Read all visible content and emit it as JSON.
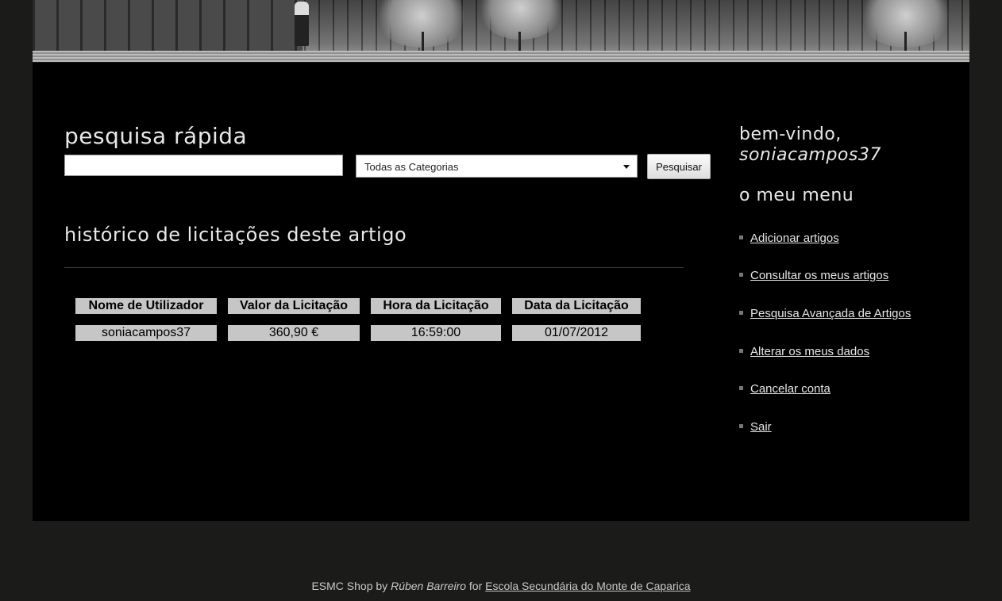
{
  "search": {
    "title": "pesquisa rápida",
    "input_value": "",
    "category_selected": "Todas as Categorias",
    "button_label": "Pesquisar"
  },
  "history": {
    "title": "histórico de licitações deste artigo",
    "columns": [
      "Nome de Utilizador",
      "Valor da Licitação",
      "Hora da Licitação",
      "Data da Licitação"
    ],
    "rows": [
      [
        "soniacampos37",
        "360,90 €",
        "16:59:00",
        "01/07/2012"
      ]
    ]
  },
  "sidebar": {
    "welcome": "bem-vindo,",
    "username": "soniacampos37",
    "menu_title": "o meu menu",
    "items": [
      {
        "label": "Adicionar artigos"
      },
      {
        "label": "Consultar os meus artigos"
      },
      {
        "label": "Pesquisa Avançada de Artigos"
      },
      {
        "label": "Alterar os meus dados"
      },
      {
        "label": "Cancelar conta"
      },
      {
        "label": "Sair"
      }
    ]
  },
  "footer": {
    "prefix": "ESMC Shop by ",
    "author": "Rúben Barreiro",
    "middle": " for ",
    "link": "Escola Secundária do Monte de Caparica"
  },
  "colors": {
    "page_bg": "#1b1b19",
    "content_bg": "#000000",
    "table_cell_bg": "#c6c6c6"
  }
}
